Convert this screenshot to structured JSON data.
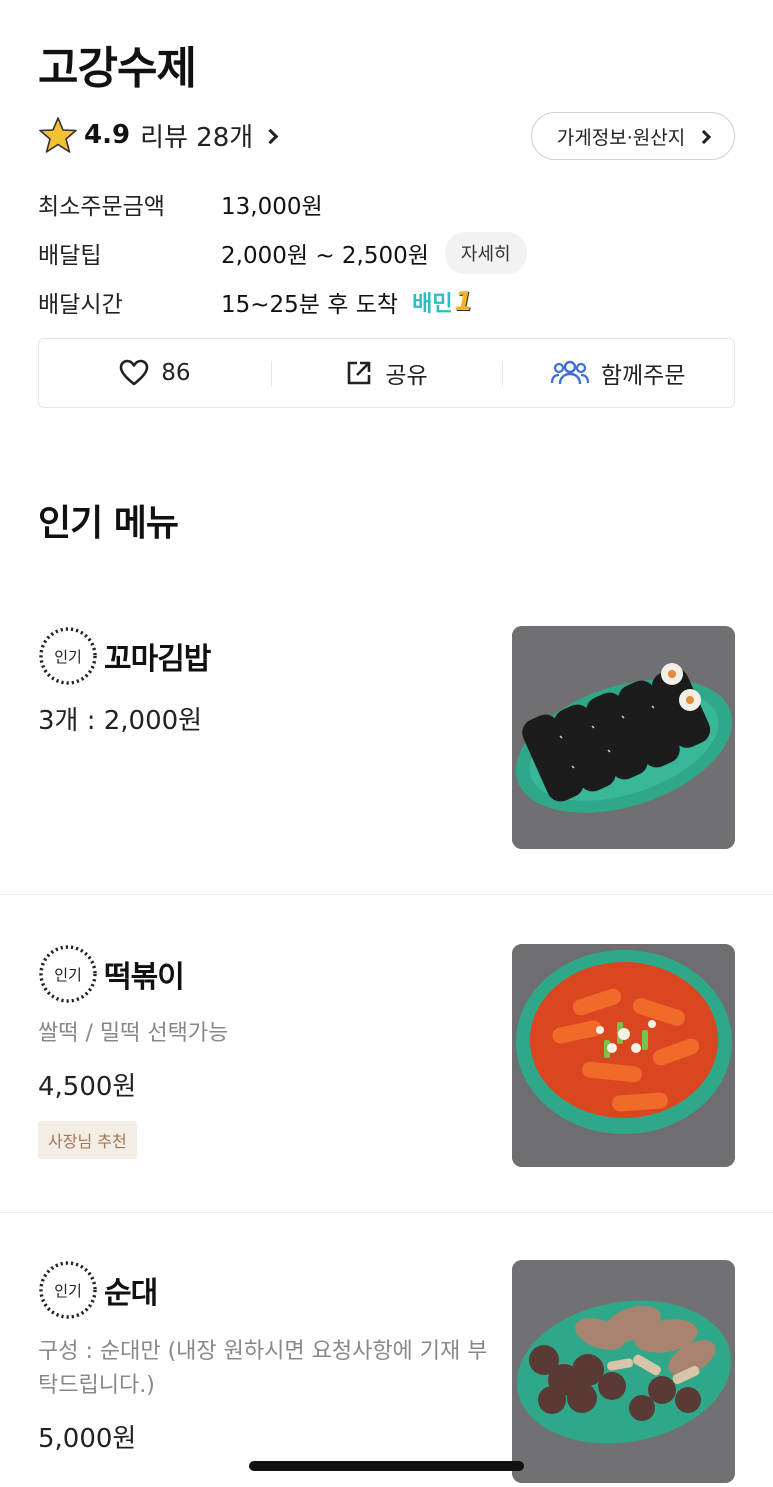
{
  "store": {
    "name": "고강수제",
    "rating": "4.9",
    "review_link": "리뷰 28개",
    "info_button": "가게정보·원산지"
  },
  "info": [
    {
      "label": "최소주문금액",
      "value": "13,000원"
    },
    {
      "label": "배달팁",
      "value": "2,000원 ~ 2,500원",
      "chip": "자세히"
    },
    {
      "label": "배달시간",
      "value": "15~25분 후 도착",
      "badge": "배민",
      "badge_num": "1"
    }
  ],
  "actions": {
    "like_count": "86",
    "share": "공유",
    "group_order": "함께주문"
  },
  "section_title": "인기 메뉴",
  "popular_label": "인기",
  "menu": [
    {
      "name": "꼬마김밥",
      "price": "3개 : 2,000원"
    },
    {
      "name": "떡볶이",
      "desc": "쌀떡 / 밀떡 선택가능",
      "price": "4,500원",
      "tag": "사장님 추천"
    },
    {
      "name": "순대",
      "desc": "구성 : 순대만 (내장 원하시면 요청사항에 기재 부탁드립니다.)",
      "price": "5,000원"
    }
  ],
  "colors": {
    "brand": "#2ac1bc",
    "star": "#f3c233",
    "group_icon": "#3d6fd8",
    "owner_tag_bg": "#f4ede6",
    "owner_tag_text": "#a07755"
  }
}
